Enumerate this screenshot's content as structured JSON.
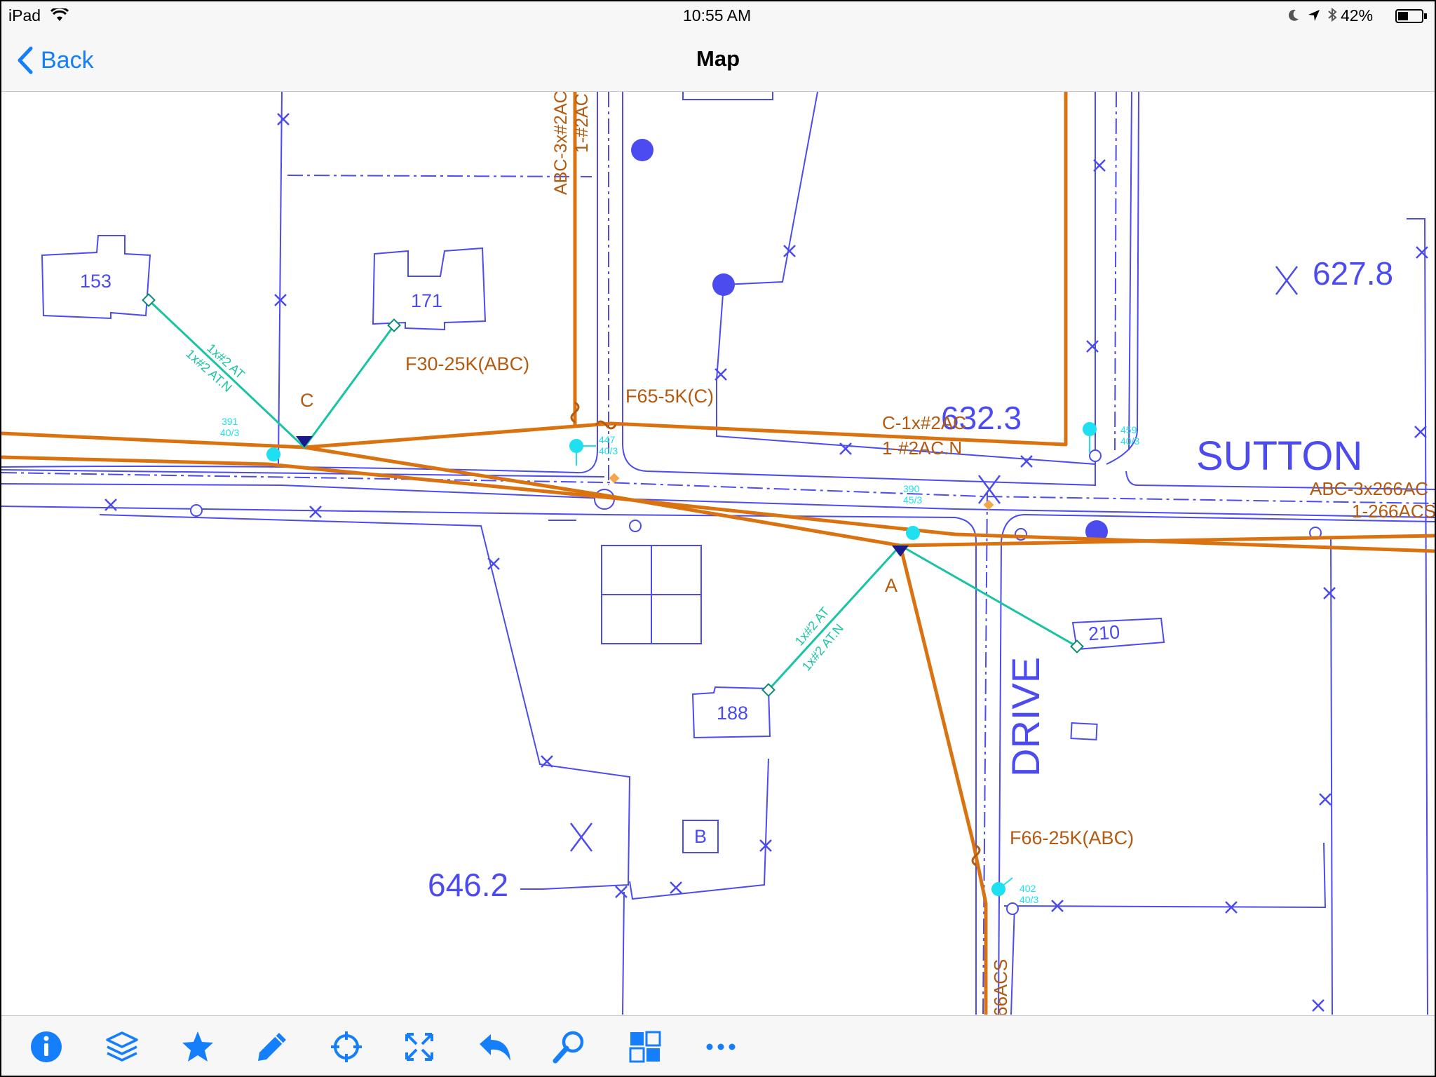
{
  "status_bar": {
    "device": "iPad",
    "time": "10:55 AM",
    "battery": "42%",
    "icons": [
      "wifi-icon",
      "moon-icon",
      "location-arrow-icon",
      "bluetooth-icon",
      "battery-icon"
    ]
  },
  "nav_bar": {
    "back_label": "Back",
    "title": "Map"
  },
  "map": {
    "elevations": [
      "627.8",
      "632.3",
      "646.2"
    ],
    "streets": [
      "SUTTON",
      "DRIVE"
    ],
    "lots": [
      "153",
      "171",
      "188",
      "210",
      "B"
    ],
    "feeders": [
      "F30-25K(ABC)",
      "F65-5K(C)",
      "F66-25K(ABC)"
    ],
    "conductors": [
      "ABC-3x#2AC",
      "1-#2AC",
      "C-1x#2AC",
      "1-#2AC.N",
      "ABC-3x266AC",
      "1-266ACS",
      "66ACS",
      "1x#2 AT",
      "1x#2 AT.N"
    ],
    "pole_labels": [
      "C",
      "A"
    ],
    "pole_tags": [
      "391",
      "40/3",
      "447",
      "40/3",
      "390",
      "45/3",
      "459",
      "40/3",
      "402",
      "40/3"
    ],
    "colors": {
      "base_map": "#4b4bf0",
      "primary_line": "#d9720f",
      "service_line": "#18c4a3",
      "pole": "#1ee0f0",
      "annotation": "#b35a10"
    }
  },
  "toolbar": {
    "accent": "#157efb",
    "buttons": [
      "info-icon",
      "layers-icon",
      "star-icon",
      "pencil-icon",
      "crosshair-icon",
      "expand-icon",
      "undo-icon",
      "search-icon",
      "grid-icon",
      "more-icon"
    ]
  }
}
